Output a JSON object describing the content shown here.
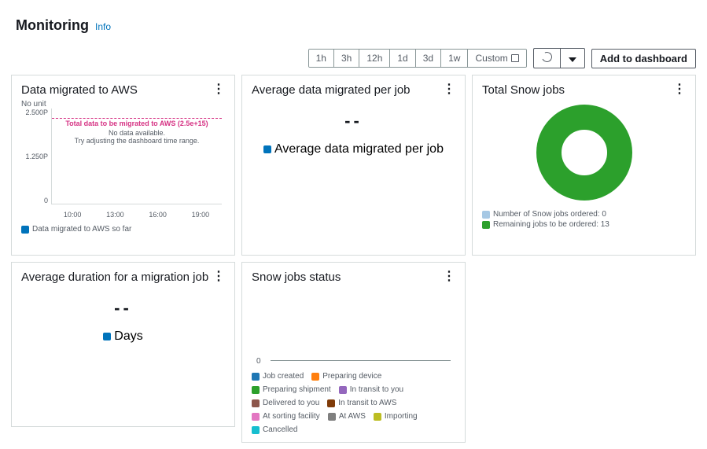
{
  "header": {
    "title": "Monitoring",
    "info_link": "Info"
  },
  "toolbar": {
    "ranges": [
      "1h",
      "3h",
      "12h",
      "1d",
      "3d",
      "1w",
      "Custom"
    ],
    "add_dashboard": "Add to dashboard"
  },
  "cards": {
    "data_migrated": {
      "title": "Data migrated to AWS",
      "unit_label": "No unit",
      "y_ticks": [
        "2.500P",
        "1.250P",
        "0"
      ],
      "target_line": "Total data to be migrated to AWS (2.5e+15)",
      "no_data": "No data available.",
      "try_adjust": "Try adjusting the dashboard time range.",
      "x_ticks": [
        "10:00",
        "13:00",
        "16:00",
        "19:00"
      ],
      "legend": "Data migrated to AWS so far",
      "legend_color": "#0073bb"
    },
    "avg_data_per_job": {
      "title": "Average data migrated per job",
      "value": "--",
      "legend": "Average data migrated per job",
      "legend_color": "#0073bb"
    },
    "total_snow": {
      "title": "Total Snow jobs",
      "legend1": "Number of Snow jobs ordered: 0",
      "legend1_color": "#a6c8e4",
      "legend2": "Remaining jobs to be ordered: 13",
      "legend2_color": "#2ca02c"
    },
    "avg_duration": {
      "title": "Average duration for a migration job",
      "value": "--",
      "legend": "Days",
      "legend_color": "#0073bb"
    },
    "snow_status": {
      "title": "Snow jobs status",
      "axis0": "0",
      "legend": [
        {
          "label": "Job created",
          "color": "#1f77b4"
        },
        {
          "label": "Preparing device",
          "color": "#ff7f0e"
        },
        {
          "label": "Preparing shipment",
          "color": "#2ca02c"
        },
        {
          "label": "In transit to you",
          "color": "#9467bd"
        },
        {
          "label": "Delivered to you",
          "color": "#8c564b"
        },
        {
          "label": "In transit to AWS",
          "color": "#7f3b08"
        },
        {
          "label": "At sorting facility",
          "color": "#e377c2"
        },
        {
          "label": "At AWS",
          "color": "#7f7f7f"
        },
        {
          "label": "Importing",
          "color": "#bcbd22"
        },
        {
          "label": "Cancelled",
          "color": "#17becf"
        }
      ]
    }
  },
  "chart_data": {
    "type": "donut",
    "title": "Total Snow jobs",
    "series": [
      {
        "name": "Number of Snow jobs ordered",
        "value": 0,
        "color": "#a6c8e4"
      },
      {
        "name": "Remaining jobs to be ordered",
        "value": 13,
        "color": "#2ca02c"
      }
    ]
  }
}
